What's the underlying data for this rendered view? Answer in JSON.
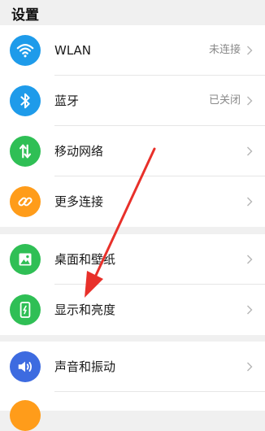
{
  "page": {
    "title": "设置"
  },
  "colors": {
    "wlan": "#1e9bea",
    "bluetooth": "#1e9bea",
    "mobile": "#2fbf55",
    "more": "#ff9c1a",
    "desktop": "#2fbf55",
    "display": "#2fbf55",
    "sound": "#3d6be0",
    "partial": "#ff9c1a",
    "annotation_arrow": "#e8302a"
  },
  "groups": [
    {
      "items": [
        {
          "label": "WLAN",
          "status": "未连接",
          "icon": "wifi-icon"
        },
        {
          "label": "蓝牙",
          "status": "已关闭",
          "icon": "bluetooth-icon"
        },
        {
          "label": "移动网络",
          "status": "",
          "icon": "mobile-data-icon"
        },
        {
          "label": "更多连接",
          "status": "",
          "icon": "link-icon"
        }
      ]
    },
    {
      "items": [
        {
          "label": "桌面和壁纸",
          "status": "",
          "icon": "image-icon"
        },
        {
          "label": "显示和亮度",
          "status": "",
          "icon": "display-brightness-icon"
        }
      ]
    },
    {
      "items": [
        {
          "label": "声音和振动",
          "status": "",
          "icon": "speaker-icon"
        }
      ]
    }
  ]
}
